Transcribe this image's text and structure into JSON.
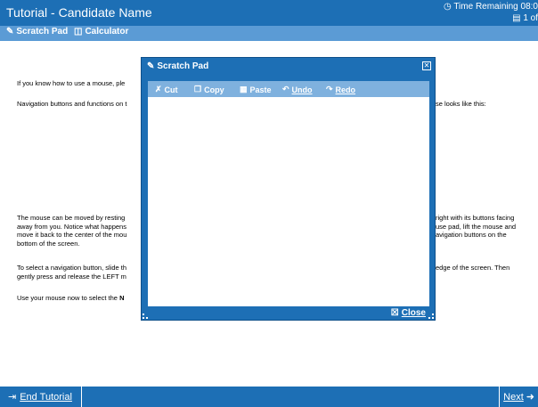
{
  "header": {
    "title": "Tutorial - Candidate Name",
    "time_remaining": "Time Remaining 08:0",
    "page_counter": "1 of"
  },
  "toolbar": {
    "scratch_pad_label": "Scratch Pad",
    "calculator_label": "Calculator"
  },
  "content": {
    "line1": "If you know how to use a mouse, ple",
    "line2_left": "Navigation buttons and functions on t",
    "line2_right": "se looks like this:",
    "para3_left": [
      "The mouse can be moved by resting",
      "away from you. Notice what happens",
      "move it back to the center of the mou",
      "bottom of the screen."
    ],
    "para3_right": [
      "right with its buttons facing",
      "use pad, lift the mouse and",
      "avigation buttons on the"
    ],
    "para4_left": [
      "To select a navigation button, slide th",
      "gently press and release the LEFT m"
    ],
    "para4_right": "edge of the screen. Then",
    "para5_left": "Use your mouse now to select the ",
    "para5_bold": "N"
  },
  "dialog": {
    "title": "Scratch Pad",
    "cut": "Cut",
    "copy": "Copy",
    "paste": "Paste",
    "undo": "Undo",
    "redo": "Redo",
    "close_label": "Close",
    "text_value": ""
  },
  "footer": {
    "end_tutorial": "End Tutorial",
    "next": "Next"
  },
  "colors": {
    "bar_blue": "#1d6fb5",
    "toolbar_blue": "#5b9bd5",
    "edit_toolbar_blue": "#7fb1de"
  }
}
